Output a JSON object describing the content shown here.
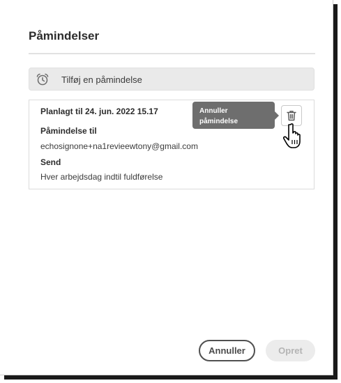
{
  "dialog": {
    "title": "Påmindelser",
    "add_reminder_label": "Tilføj en påmindelse"
  },
  "reminder": {
    "scheduled": "Planlagt til 24. jun. 2022 15.17",
    "recipient_heading": "Påmindelse til",
    "recipient_email": "echosignone+na1revieewtony@gmail.com",
    "send_heading": "Send",
    "send_frequency": "Hver arbejdsdag indtil fuldførelse"
  },
  "tooltip": {
    "line1": "Annuller",
    "line2": "påmindelse"
  },
  "icons": {
    "add_reminder": "alarm-clock-icon",
    "delete": "trash-icon",
    "pointer": "hand-pointer-cursor-icon"
  },
  "footer": {
    "cancel_label": "Annuller",
    "create_label": "Opret"
  }
}
